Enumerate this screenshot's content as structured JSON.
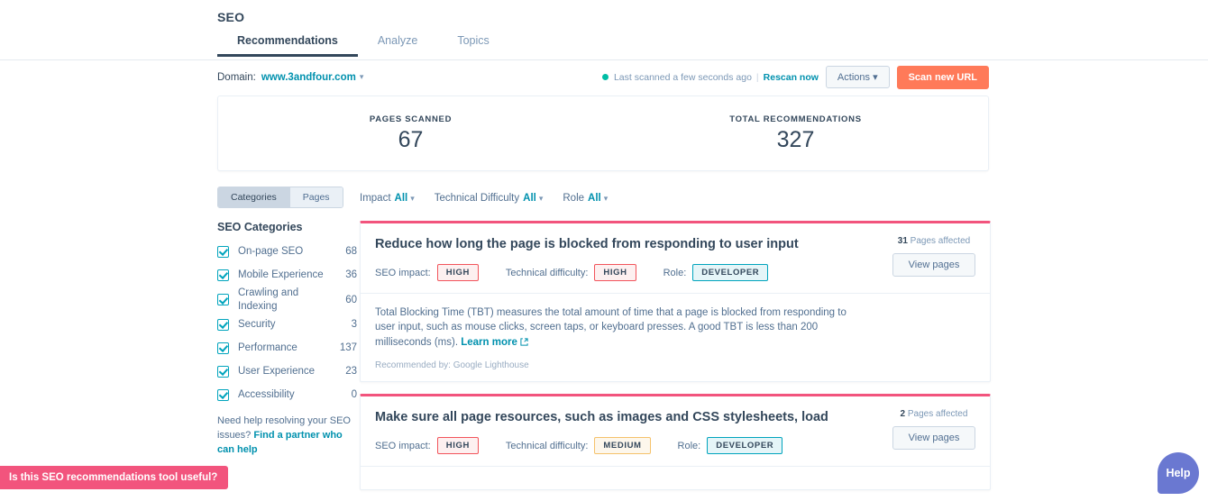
{
  "header": {
    "title": "SEO",
    "tabs": [
      {
        "label": "Recommendations",
        "active": true
      },
      {
        "label": "Analyze",
        "active": false
      },
      {
        "label": "Topics",
        "active": false
      }
    ]
  },
  "domain_bar": {
    "label": "Domain:",
    "value": "www.3andfour.com",
    "caret": "▾",
    "scan_status": "Last scanned a few seconds ago",
    "separator": "|",
    "rescan_label": "Rescan now",
    "actions_label": "Actions",
    "actions_caret": "▾",
    "scan_new_url_label": "Scan new URL",
    "status_dot_color": "#00bda5"
  },
  "stats": [
    {
      "label": "PAGES SCANNED",
      "value": "67"
    },
    {
      "label": "TOTAL RECOMMENDATIONS",
      "value": "327"
    }
  ],
  "sidebar": {
    "toggle": [
      {
        "label": "Categories",
        "active": true
      },
      {
        "label": "Pages",
        "active": false
      }
    ],
    "title": "SEO Categories",
    "categories": [
      {
        "name": "On-page SEO",
        "count": "68",
        "checked": true
      },
      {
        "name": "Mobile Experience",
        "count": "36",
        "checked": true
      },
      {
        "name": "Crawling and Indexing",
        "count": "60",
        "checked": true
      },
      {
        "name": "Security",
        "count": "3",
        "checked": true
      },
      {
        "name": "Performance",
        "count": "137",
        "checked": true
      },
      {
        "name": "User Experience",
        "count": "23",
        "checked": true
      },
      {
        "name": "Accessibility",
        "count": "0",
        "checked": true
      }
    ],
    "help_text": "Need help resolving your SEO issues? ",
    "help_link": "Find a partner who can help"
  },
  "filters": [
    {
      "label": "Impact",
      "value": "All",
      "caret": "▾"
    },
    {
      "label": "Technical Difficulty",
      "value": "All",
      "caret": "▾"
    },
    {
      "label": "Role",
      "value": "All",
      "caret": "▾"
    }
  ],
  "recommendations": [
    {
      "title": "Reduce how long the page is blocked from responding to user input",
      "impact_label": "SEO impact:",
      "impact_value": "HIGH",
      "impact_kind": "high",
      "difficulty_label": "Technical difficulty:",
      "difficulty_value": "HIGH",
      "difficulty_kind": "high",
      "role_label": "Role:",
      "role_value": "DEVELOPER",
      "pages_count": "31",
      "pages_affected_label": "Pages affected",
      "view_pages_label": "View pages",
      "description": "Total Blocking Time (TBT) measures the total amount of time that a page is blocked from responding to user input, such as mouse clicks, screen taps, or keyboard presses. A good TBT is less than 200 milliseconds (ms). ",
      "learn_more_label": "Learn more",
      "source": "Recommended by: Google Lighthouse"
    },
    {
      "title": "Make sure all page resources, such as images and CSS stylesheets, load",
      "impact_label": "SEO impact:",
      "impact_value": "HIGH",
      "impact_kind": "high",
      "difficulty_label": "Technical difficulty:",
      "difficulty_value": "MEDIUM",
      "difficulty_kind": "medium",
      "role_label": "Role:",
      "role_value": "DEVELOPER",
      "pages_count": "2",
      "pages_affected_label": "Pages affected",
      "view_pages_label": "View pages",
      "description": "",
      "learn_more_label": "",
      "source": ""
    }
  ],
  "widgets": {
    "feedback_label": "Is this SEO recommendations tool useful?",
    "help_label": "Help"
  },
  "colors": {
    "accent_orange": "#ff7a59",
    "accent_teal": "#0091ae",
    "card_top_border": "#f2547d",
    "high_badge": "#f2545b",
    "medium_badge": "#f5c26b",
    "developer_badge": "#00a4bd",
    "help_fab": "#6a78d1"
  }
}
